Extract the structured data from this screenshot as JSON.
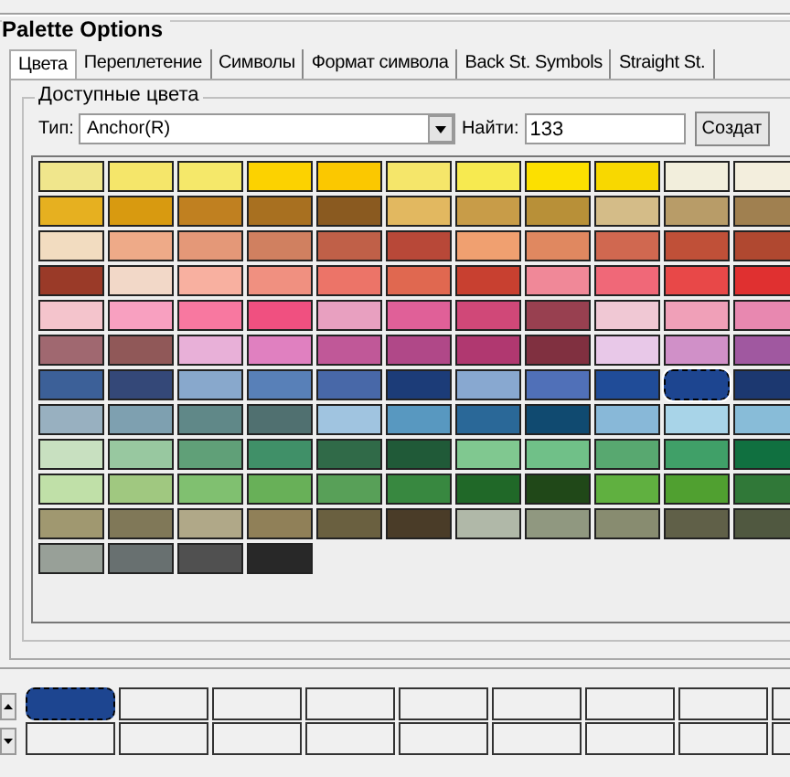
{
  "group_title": "Palette Options",
  "tabs": [
    {
      "label": "Цвета",
      "selected": true
    },
    {
      "label": "Переплетение",
      "selected": false
    },
    {
      "label": "Символы",
      "selected": false
    },
    {
      "label": "Формат символа",
      "selected": false
    },
    {
      "label": "Back St. Symbols",
      "selected": false
    },
    {
      "label": "Straight St.",
      "selected": false
    }
  ],
  "colors_group": {
    "title": "Доступные цвета",
    "type_label": "Тип:",
    "type_value": "Anchor(R)",
    "find_label": "Найти:",
    "find_value": "133",
    "create_button": "Создат"
  },
  "swatches": [
    [
      {
        "color": "#f0e68c",
        "selected": false
      },
      {
        "color": "#f5e66a",
        "selected": false
      },
      {
        "color": "#f5e86a",
        "selected": false
      },
      {
        "color": "#fcd200",
        "selected": false
      },
      {
        "color": "#fbc800",
        "selected": false
      },
      {
        "color": "#f5e66a",
        "selected": false
      },
      {
        "color": "#f7ea50",
        "selected": false
      },
      {
        "color": "#fce000",
        "selected": false
      },
      {
        "color": "#f8d800",
        "selected": false
      },
      {
        "color": "#f2eedc",
        "selected": false
      },
      {
        "color": "#f3eedd",
        "selected": false
      }
    ],
    [
      {
        "color": "#e6b020",
        "selected": false
      },
      {
        "color": "#d89a10",
        "selected": false
      },
      {
        "color": "#c08020",
        "selected": false
      },
      {
        "color": "#a87020",
        "selected": false
      },
      {
        "color": "#8a5a20",
        "selected": false
      },
      {
        "color": "#e2b860",
        "selected": false
      },
      {
        "color": "#c89c48",
        "selected": false
      },
      {
        "color": "#b89038",
        "selected": false
      },
      {
        "color": "#d4bc88",
        "selected": false
      },
      {
        "color": "#b89c68",
        "selected": false
      },
      {
        "color": "#a08050",
        "selected": false
      }
    ],
    [
      {
        "color": "#f2dcc0",
        "selected": false
      },
      {
        "color": "#eeaa88",
        "selected": false
      },
      {
        "color": "#e49878",
        "selected": false
      },
      {
        "color": "#d08060",
        "selected": false
      },
      {
        "color": "#c06048",
        "selected": false
      },
      {
        "color": "#b84838",
        "selected": false
      },
      {
        "color": "#f0a070",
        "selected": false
      },
      {
        "color": "#e08860",
        "selected": false
      },
      {
        "color": "#d06850",
        "selected": false
      },
      {
        "color": "#c05038",
        "selected": false
      },
      {
        "color": "#b04830",
        "selected": false
      }
    ],
    [
      {
        "color": "#9a3a28",
        "selected": false
      },
      {
        "color": "#f2d8c8",
        "selected": false
      },
      {
        "color": "#f8b0a0",
        "selected": false
      },
      {
        "color": "#f09080",
        "selected": false
      },
      {
        "color": "#ec7468",
        "selected": false
      },
      {
        "color": "#e06850",
        "selected": false
      },
      {
        "color": "#c84030",
        "selected": false
      },
      {
        "color": "#f08898",
        "selected": false
      },
      {
        "color": "#f06878",
        "selected": false
      },
      {
        "color": "#e84848",
        "selected": false
      },
      {
        "color": "#e03030",
        "selected": false
      }
    ],
    [
      {
        "color": "#f4c4cc",
        "selected": false
      },
      {
        "color": "#f8a0c0",
        "selected": false
      },
      {
        "color": "#f878a0",
        "selected": false
      },
      {
        "color": "#f05080",
        "selected": false
      },
      {
        "color": "#e8a0c0",
        "selected": false
      },
      {
        "color": "#e06098",
        "selected": false
      },
      {
        "color": "#d04878",
        "selected": false
      },
      {
        "color": "#984050",
        "selected": false
      },
      {
        "color": "#f0c8d4",
        "selected": false
      },
      {
        "color": "#f0a0b8",
        "selected": false
      },
      {
        "color": "#e888b0",
        "selected": false
      }
    ],
    [
      {
        "color": "#a06870",
        "selected": false
      },
      {
        "color": "#905858",
        "selected": false
      },
      {
        "color": "#e8b0d8",
        "selected": false
      },
      {
        "color": "#e080c0",
        "selected": false
      },
      {
        "color": "#c05898",
        "selected": false
      },
      {
        "color": "#b04888",
        "selected": false
      },
      {
        "color": "#b03870",
        "selected": false
      },
      {
        "color": "#803040",
        "selected": false
      },
      {
        "color": "#e8c8e8",
        "selected": false
      },
      {
        "color": "#d090c8",
        "selected": false
      },
      {
        "color": "#a058a0",
        "selected": false
      }
    ],
    [
      {
        "color": "#3c6098",
        "selected": false
      },
      {
        "color": "#344878",
        "selected": false
      },
      {
        "color": "#88a8cc",
        "selected": false
      },
      {
        "color": "#5880b8",
        "selected": false
      },
      {
        "color": "#4868a8",
        "selected": false
      },
      {
        "color": "#1c3c78",
        "selected": false
      },
      {
        "color": "#88a8d0",
        "selected": false
      },
      {
        "color": "#5070b8",
        "selected": false
      },
      {
        "color": "#204c98",
        "selected": false
      },
      {
        "color": "#1d4590",
        "selected": true
      },
      {
        "color": "#1c3870",
        "selected": false
      }
    ],
    [
      {
        "color": "#98b0c0",
        "selected": false
      },
      {
        "color": "#7ea0b0",
        "selected": false
      },
      {
        "color": "#608888",
        "selected": false
      },
      {
        "color": "#507070",
        "selected": false
      },
      {
        "color": "#a0c4e0",
        "selected": false
      },
      {
        "color": "#5898c0",
        "selected": false
      },
      {
        "color": "#2a6898",
        "selected": false
      },
      {
        "color": "#104a70",
        "selected": false
      },
      {
        "color": "#88b8d8",
        "selected": false
      },
      {
        "color": "#a8d4e8",
        "selected": false
      },
      {
        "color": "#88bcd8",
        "selected": false
      }
    ],
    [
      {
        "color": "#c8e0c0",
        "selected": false
      },
      {
        "color": "#98c8a0",
        "selected": false
      },
      {
        "color": "#60a078",
        "selected": false
      },
      {
        "color": "#409068",
        "selected": false
      },
      {
        "color": "#306a48",
        "selected": false
      },
      {
        "color": "#205a38",
        "selected": false
      },
      {
        "color": "#80c890",
        "selected": false
      },
      {
        "color": "#70c088",
        "selected": false
      },
      {
        "color": "#58a870",
        "selected": false
      },
      {
        "color": "#40a068",
        "selected": false
      },
      {
        "color": "#107040",
        "selected": false
      }
    ],
    [
      {
        "color": "#c0e0a8",
        "selected": false
      },
      {
        "color": "#a0c880",
        "selected": false
      },
      {
        "color": "#80c070",
        "selected": false
      },
      {
        "color": "#68b058",
        "selected": false
      },
      {
        "color": "#58a058",
        "selected": false
      },
      {
        "color": "#388840",
        "selected": false
      },
      {
        "color": "#206828",
        "selected": false
      },
      {
        "color": "#204818",
        "selected": false
      },
      {
        "color": "#60b040",
        "selected": false
      },
      {
        "color": "#50a030",
        "selected": false
      },
      {
        "color": "#307838",
        "selected": false
      }
    ],
    [
      {
        "color": "#a09870",
        "selected": false
      },
      {
        "color": "#807858",
        "selected": false
      },
      {
        "color": "#b0a888",
        "selected": false
      },
      {
        "color": "#908058",
        "selected": false
      },
      {
        "color": "#6a6040",
        "selected": false
      },
      {
        "color": "#4a3c28",
        "selected": false
      },
      {
        "color": "#b0b8a8",
        "selected": false
      },
      {
        "color": "#909880",
        "selected": false
      },
      {
        "color": "#888c70",
        "selected": false
      },
      {
        "color": "#606048",
        "selected": false
      },
      {
        "color": "#505840",
        "selected": false
      }
    ],
    [
      {
        "color": "#98a098",
        "selected": false
      },
      {
        "color": "#687070",
        "selected": false
      },
      {
        "color": "#505050",
        "selected": false
      },
      {
        "color": "#282828",
        "selected": false
      }
    ]
  ],
  "palette_slots": [
    [
      {
        "filled": true,
        "color": "#1d4590"
      },
      {
        "filled": false
      },
      {
        "filled": false
      },
      {
        "filled": false
      },
      {
        "filled": false
      },
      {
        "filled": false
      },
      {
        "filled": false
      },
      {
        "filled": false
      },
      {
        "filled": false
      }
    ],
    [
      {
        "filled": false
      },
      {
        "filled": false
      },
      {
        "filled": false
      },
      {
        "filled": false
      },
      {
        "filled": false
      },
      {
        "filled": false
      },
      {
        "filled": false
      },
      {
        "filled": false
      },
      {
        "filled": false
      }
    ]
  ]
}
